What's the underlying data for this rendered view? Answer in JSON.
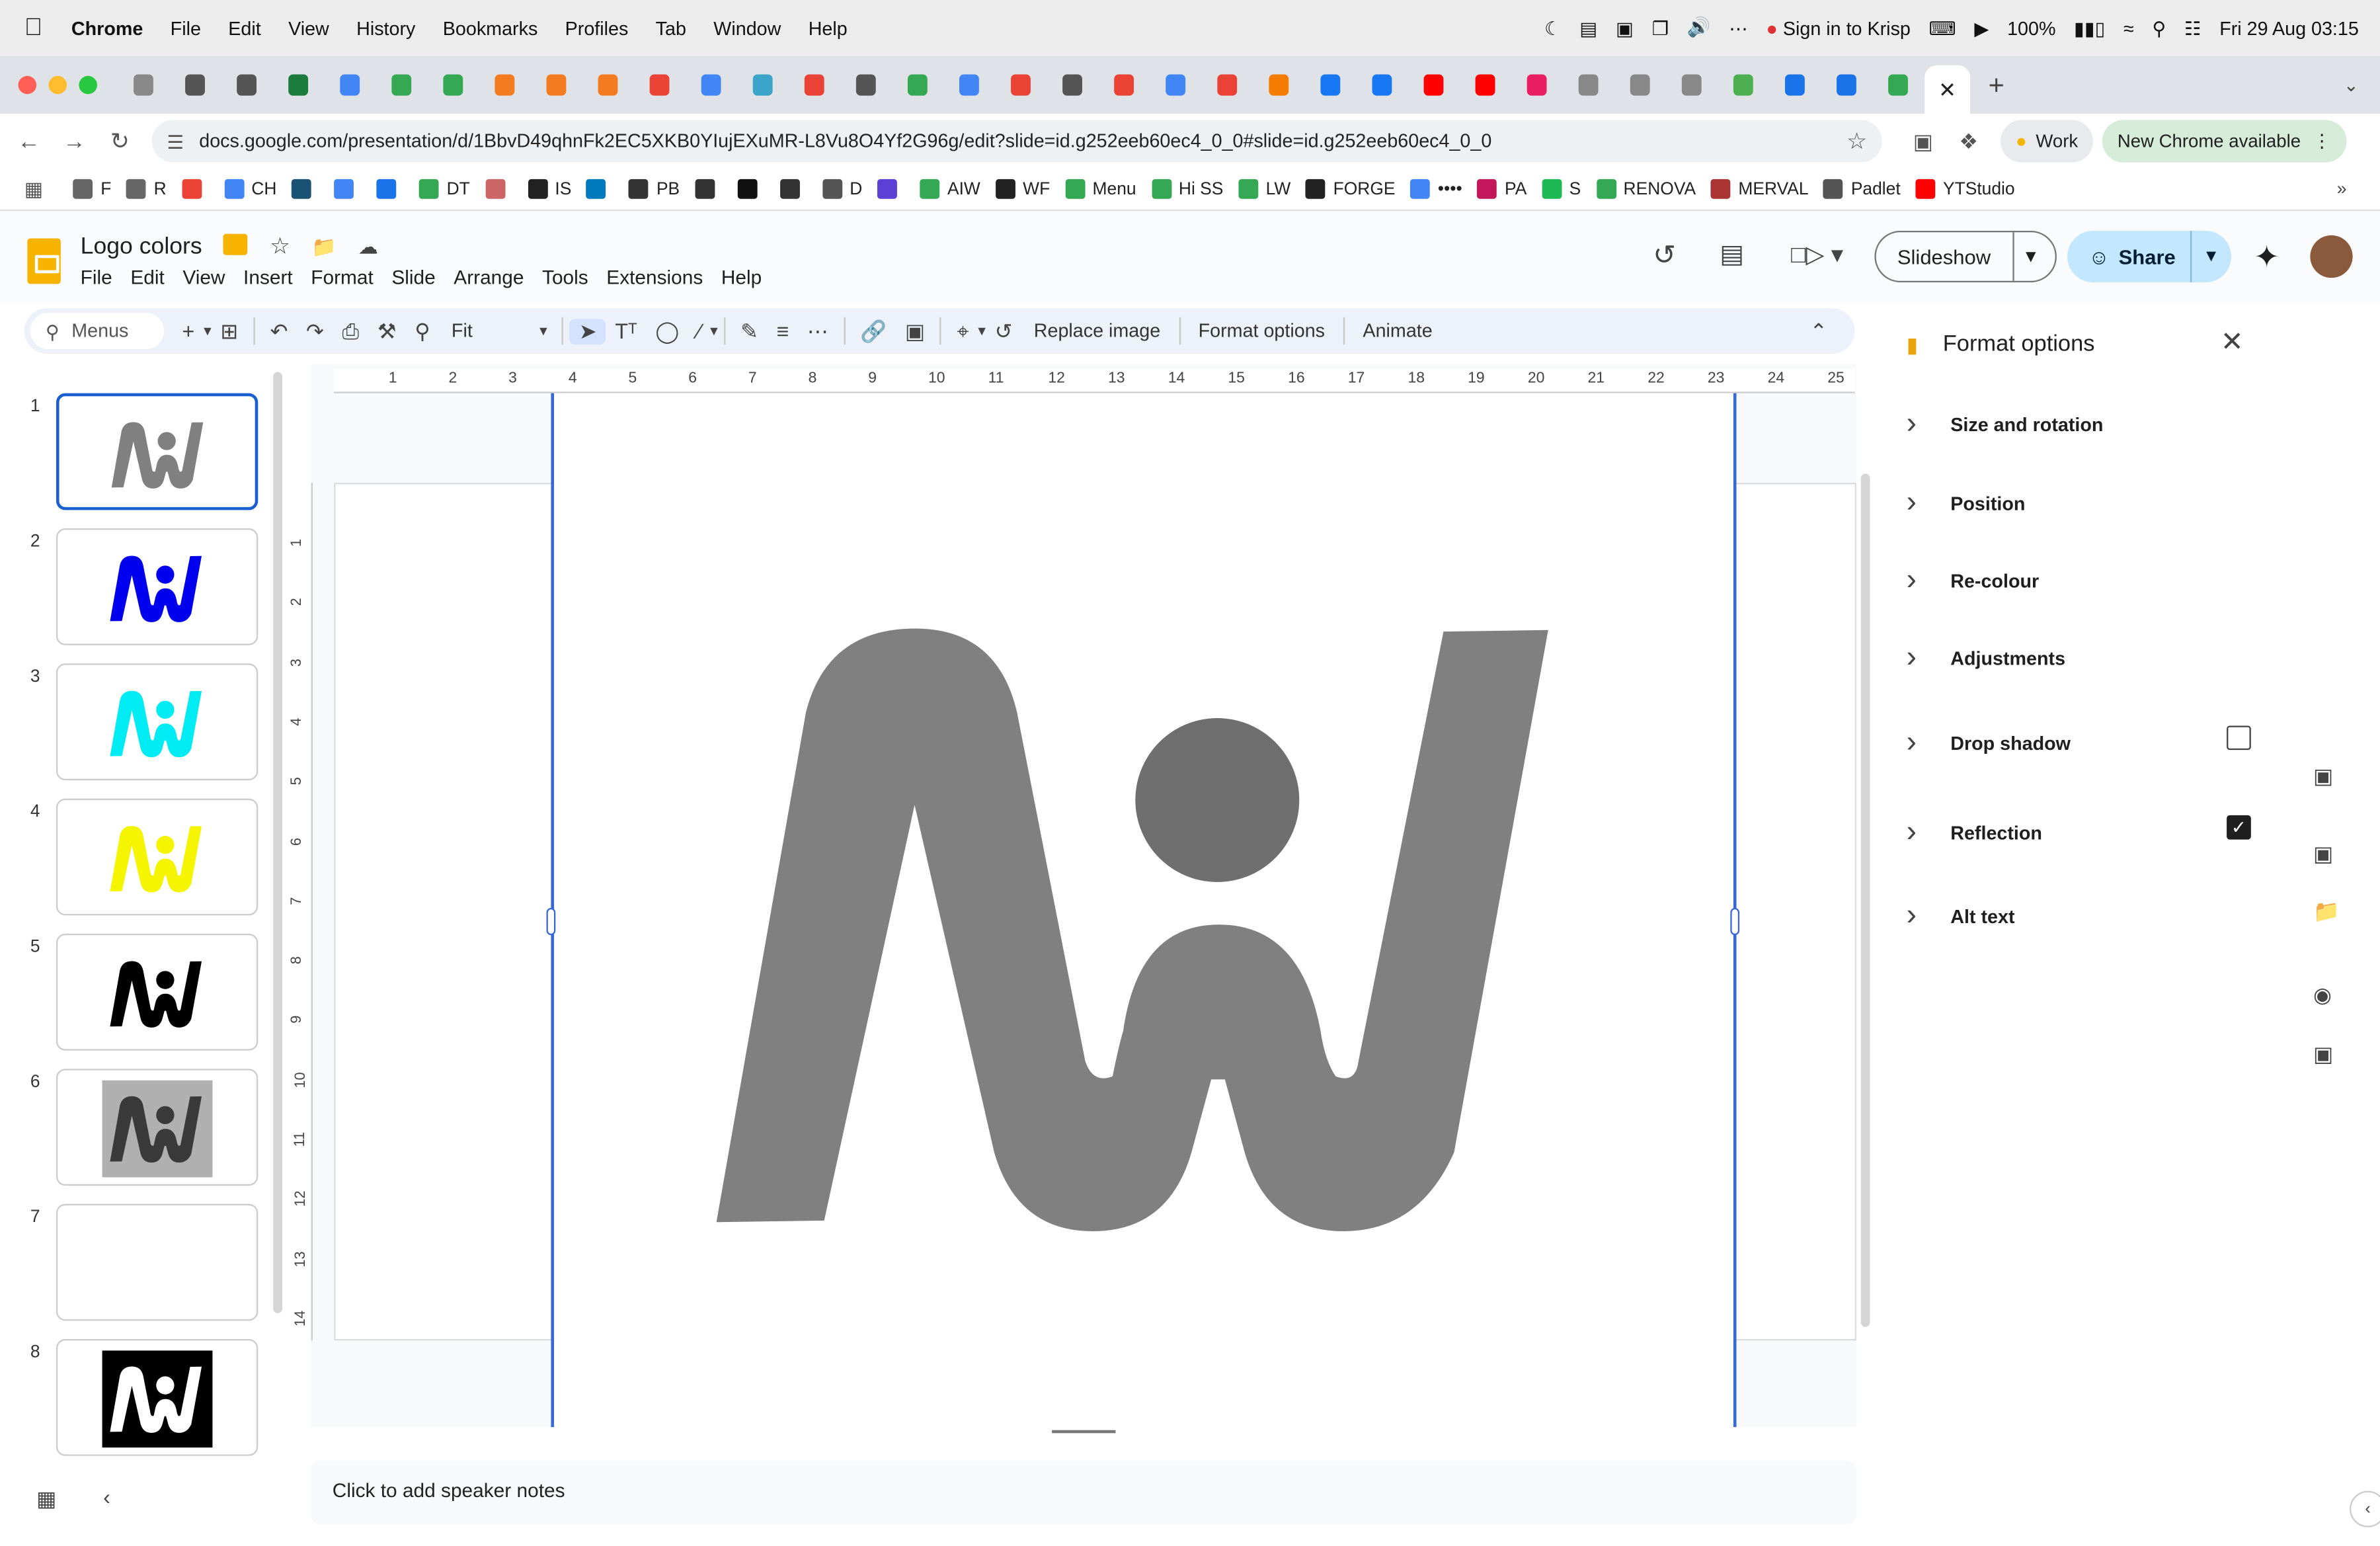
{
  "macos_menubar": {
    "app": "Chrome",
    "items": [
      "File",
      "Edit",
      "View",
      "History",
      "Bookmarks",
      "Profiles",
      "Tab",
      "Window",
      "Help"
    ],
    "krisp": "Sign in to Krisp",
    "battery": "100%",
    "datetime": "Fri 29 Aug  03:15"
  },
  "browser": {
    "url": "docs.google.com/presentation/d/1BbvD49qhnFk2EC5XKB0YIujEXuMR-L8Vu8O4Yf2G96g/edit?slide=id.g252eeb60ec4_0_0#slide=id.g252eeb60ec4_0_0",
    "profile": "Work",
    "update": "New Chrome available",
    "active_tab_close": "✕",
    "new_tab": "+",
    "tab_icon_colors": [
      "#888",
      "#555",
      "#555",
      "#1a7b3c",
      "#4285f4",
      "#34a853",
      "#34a853",
      "#f47c20",
      "#f47c20",
      "#f47c20",
      "#ea4335",
      "#4285f4",
      "#3aa5c9",
      "#ea4335",
      "#555",
      "#34a853",
      "#4285f4",
      "#ea4335",
      "#555",
      "#ea4335",
      "#4285f4",
      "#ea4335",
      "#f57c00",
      "#1877f2",
      "#1877f2",
      "#ff0000",
      "#ff0000",
      "#e91e63",
      "#888",
      "#888",
      "#888",
      "#4caf50",
      "#1a73e8",
      "#1a73e8",
      "#34a853"
    ]
  },
  "bookmarks": [
    {
      "label": "F",
      "color": "#666"
    },
    {
      "label": "R",
      "color": "#666"
    },
    {
      "label": "",
      "color": "#ea4335"
    },
    {
      "label": "CH",
      "color": "#4285f4"
    },
    {
      "label": "",
      "color": "#1a5276"
    },
    {
      "label": "",
      "color": "#4285f4"
    },
    {
      "label": "",
      "color": "#1a73e8"
    },
    {
      "label": "DT",
      "color": "#34a853"
    },
    {
      "label": "",
      "color": "#c66"
    },
    {
      "label": "IS",
      "color": "#222"
    },
    {
      "label": "",
      "color": "#0079bf"
    },
    {
      "label": "PB",
      "color": "#333"
    },
    {
      "label": "",
      "color": "#333"
    },
    {
      "label": "",
      "color": "#111"
    },
    {
      "label": "",
      "color": "#333"
    },
    {
      "label": "D",
      "color": "#555"
    },
    {
      "label": "",
      "color": "#5b3fd6"
    },
    {
      "label": "AIW",
      "color": "#34a853"
    },
    {
      "label": "WF",
      "color": "#222"
    },
    {
      "label": "Menu",
      "color": "#34a853"
    },
    {
      "label": "Hi SS",
      "color": "#34a853"
    },
    {
      "label": "LW",
      "color": "#34a853"
    },
    {
      "label": "FORGE",
      "color": "#222"
    },
    {
      "label": "••••",
      "color": "#4285f4"
    },
    {
      "label": "PA",
      "color": "#c2185b"
    },
    {
      "label": "S",
      "color": "#1db954"
    },
    {
      "label": "RENOVA",
      "color": "#34a853"
    },
    {
      "label": "MERVAL",
      "color": "#a33"
    },
    {
      "label": "Padlet",
      "color": "#555"
    },
    {
      "label": "YTStudio",
      "color": "#ff0000"
    }
  ],
  "doc": {
    "title": "Logo colors",
    "menus": [
      "File",
      "Edit",
      "View",
      "Insert",
      "Format",
      "Slide",
      "Arrange",
      "Tools",
      "Extensions",
      "Help"
    ],
    "slideshow_label": "Slideshow",
    "share_label": "Share"
  },
  "toolbar": {
    "search_placeholder": "Menus",
    "zoom": "Fit",
    "replace_image": "Replace image",
    "format_options": "Format options",
    "animate": "Animate"
  },
  "slides": [
    {
      "num": "1",
      "color": "#808080",
      "selected": true,
      "bg": "#ffffff"
    },
    {
      "num": "2",
      "color": "#0000ee",
      "selected": false,
      "bg": "#ffffff"
    },
    {
      "num": "3",
      "color": "#00ecf5",
      "selected": false,
      "bg": "#ffffff"
    },
    {
      "num": "4",
      "color": "#f5f500",
      "selected": false,
      "bg": "#ffffff"
    },
    {
      "num": "5",
      "color": "#000000",
      "selected": false,
      "bg": "#ffffff"
    },
    {
      "num": "6",
      "color": "#3a3a3a",
      "selected": false,
      "bg": "#b0b0b0"
    },
    {
      "num": "7",
      "color": "",
      "selected": false,
      "bg": "#ffffff"
    },
    {
      "num": "8",
      "color": "#ffffff",
      "selected": false,
      "bg": "#000000"
    }
  ],
  "rulers": {
    "horizontal": [
      "1",
      "2",
      "3",
      "4",
      "5",
      "6",
      "7",
      "8",
      "9",
      "10",
      "11",
      "12",
      "13",
      "14",
      "15",
      "16",
      "17",
      "18",
      "19",
      "20",
      "21",
      "22",
      "23",
      "24",
      "25"
    ],
    "vertical": [
      "1",
      "2",
      "3",
      "4",
      "5",
      "6",
      "7",
      "8",
      "9",
      "10",
      "11",
      "12",
      "13",
      "14"
    ]
  },
  "canvas": {
    "logo_color": "#808080",
    "logo_dot_color": "#6f6f6f"
  },
  "notes": {
    "placeholder": "Click to add speaker notes"
  },
  "format_panel": {
    "title": "Format options",
    "sections": [
      {
        "label": "Size and rotation",
        "checkbox": null
      },
      {
        "label": "Position",
        "checkbox": null
      },
      {
        "label": "Re-colour",
        "checkbox": null
      },
      {
        "label": "Adjustments",
        "checkbox": null
      },
      {
        "label": "Drop shadow",
        "checkbox": false
      },
      {
        "label": "Reflection",
        "checkbox": true
      },
      {
        "label": "Alt text",
        "checkbox": null
      }
    ]
  }
}
